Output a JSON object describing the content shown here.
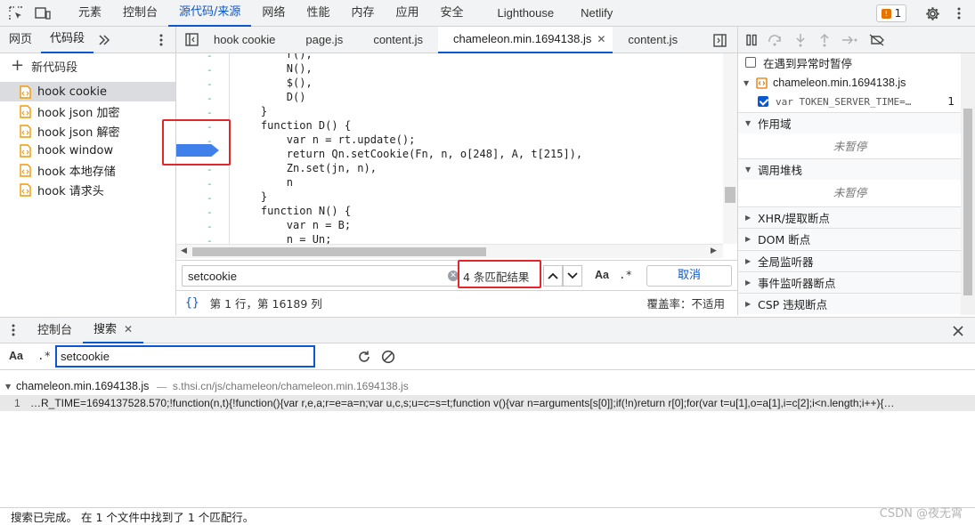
{
  "topbar": {
    "tabs": [
      "元素",
      "控制台",
      "源代码/来源",
      "网络",
      "性能",
      "内存",
      "应用",
      "安全",
      "Lighthouse",
      "Netlify"
    ],
    "active_tab": "源代码/来源",
    "issues_count": "1"
  },
  "navigator": {
    "tabs": [
      "网页",
      "代码段"
    ],
    "new_snippet": "新代码段",
    "snippets": [
      "hook cookie",
      "hook json 加密",
      "hook json 解密",
      "hook window",
      "hook 本地存储",
      "hook 请求头"
    ]
  },
  "editor": {
    "tabs": [
      "hook cookie",
      "page.js",
      "content.js",
      "chameleon.min.1694138.js",
      "content.js"
    ],
    "active_tab": "chameleon.min.1694138.js",
    "code_lines": [
      "        r(),",
      "        N(),",
      "        $(),",
      "        D()",
      "    }",
      "    function D() {",
      "        var n = rt.update();",
      "        return Qn.setCookie(Fn, n, o[248], A, t[215]),",
      "        Zn.set(jn, n),",
      "        n",
      "    }",
      "    function N() {",
      "        var n = B;",
      "        n = Un;"
    ],
    "gutter_mark": "-"
  },
  "find": {
    "query": "setcookie",
    "match_count": "4 条匹配结果",
    "case_label": "Aa",
    "regex_label": ".*",
    "cancel": "取消"
  },
  "status": {
    "braces": "{}",
    "position": "第 1 行，第 16189 列",
    "coverage": "覆盖率：不适用"
  },
  "debugger": {
    "pause_on_exceptions": "在遇到异常时暂停",
    "breakpoint_file": "chameleon.min.1694138.js",
    "breakpoint_code": "var TOKEN_SERVER_TIME=…",
    "breakpoint_line": "1",
    "scope_title": "作用域",
    "not_paused": "未暂停",
    "callstack_title": "调用堆栈",
    "sections": [
      "XHR/提取断点",
      "DOM 断点",
      "全局监听器",
      "事件监听器断点",
      "CSP 违规断点"
    ]
  },
  "drawer": {
    "tabs": [
      "控制台",
      "搜索"
    ],
    "active_tab": "搜索",
    "case_label": "Aa",
    "regex_label": ".*",
    "query": "setcookie"
  },
  "results": {
    "file_name": "chameleon.min.1694138.js",
    "file_path": "s.thsi.cn/js/chameleon/chameleon.min.1694138.js",
    "line_number": "1",
    "line_text": "…R_TIME=1694137528.570;!function(n,t){!function(){var r,e,a;r=e=a=n;var u,c,s;u=c=s=t;function v(){var n=arguments[s[0]];if(!n)return r[0];for(var t=u[1],o=a[1],i=c[2];i<n.length;i++){…"
  },
  "footer": {
    "status": "搜索已完成。 在 1 个文件中找到了 1 个匹配行。"
  },
  "watermark": "CSDN @夜无霄",
  "colors": {
    "accent": "#0b57d0",
    "breakpoint": "#3f80ea",
    "annotation": "#e4262b"
  }
}
